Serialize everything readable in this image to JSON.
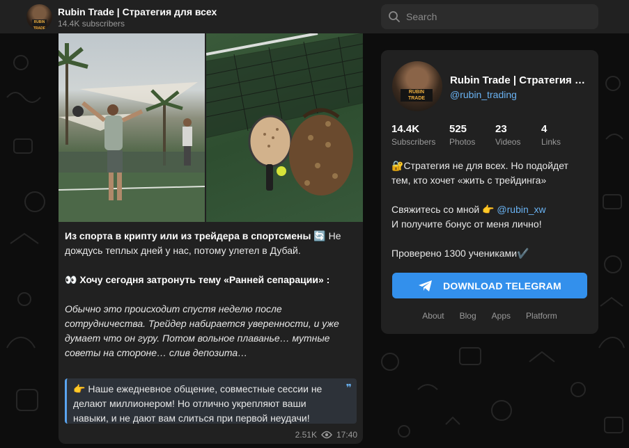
{
  "header": {
    "channel_title": "Rubin Trade | Стратегия для всех",
    "subscribers": "14.4K subscribers",
    "avatar_badge": "RUBIN TRADE",
    "search_placeholder": "Search"
  },
  "post": {
    "heading": "Из спорта в крипту или из трейдера в спортсмены",
    "heading_emoji": "🔄",
    "heading_rest": " Не дождусь теплых дней у нас, потому улетел в Дубай.",
    "topic_emoji": "👀",
    "topic": " Хочу сегодня затронуть тему «Ранней сепарации» :",
    "italic_text": "Обычно это происходит спустя неделю после сотрудничества. Трейдер набирается уверенности, и уже думает что он гуру. Потом вольное плаванье… мутные советы на стороне… слив депозита…",
    "quote_emoji": "👉",
    "quote_text": " Наше ежедневное общение, совместные сессии не делают миллионером! Но отлично укрепляют ваши навыки, и не дают вам слиться при первой неудачи!",
    "quote_mark": "❞",
    "views": "2.51K",
    "time": "17:40"
  },
  "profile": {
    "name": "Rubin Trade | Стратегия для всех",
    "handle": "@rubin_trading",
    "avatar_badge": "RUBIN TRADE",
    "stats": [
      {
        "value": "14.4K",
        "label": "Subscribers"
      },
      {
        "value": "525",
        "label": "Photos"
      },
      {
        "value": "23",
        "label": "Videos"
      },
      {
        "value": "4",
        "label": "Links"
      }
    ],
    "about_line1_emoji": "🔐",
    "about_line1": "Стратегия не для всех. Но подойдет тем, кто хочет «жить с трейдинга»",
    "contact_text": "Свяжитесь со мной ",
    "contact_emoji": "👉",
    "contact_link": "@rubin_xw",
    "bonus_text": "И получите бонус от меня лично!",
    "checked_text": "Проверено 1300 учениками",
    "checked_emoji": "✔️",
    "download_button": "DOWNLOAD TELEGRAM",
    "footer_links": [
      "About",
      "Blog",
      "Apps",
      "Platform"
    ]
  },
  "colors": {
    "accent": "#3390ec",
    "link": "#6ab3f3",
    "panel": "#212121",
    "background": "#0d0d0d"
  }
}
